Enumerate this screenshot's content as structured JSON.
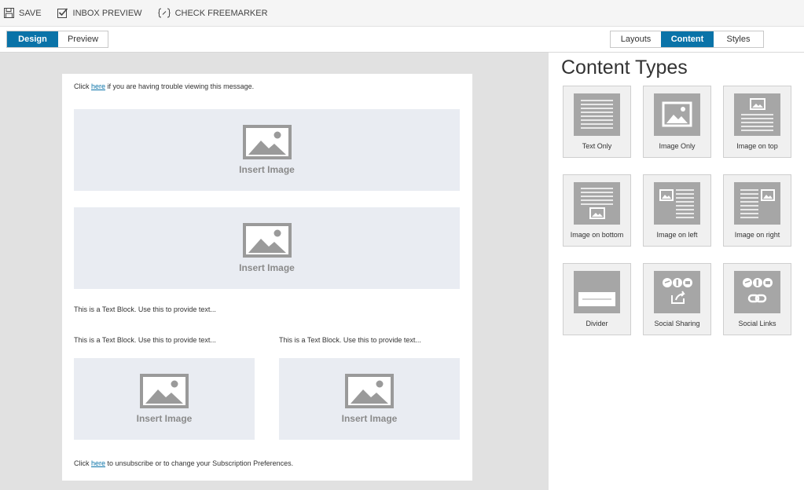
{
  "toolbar": {
    "save": "SAVE",
    "inbox_preview": "INBOX PREVIEW",
    "check_freemarker": "CHECK FREEMARKER"
  },
  "view_tabs": {
    "design": "Design",
    "preview": "Preview",
    "active": "Design"
  },
  "panel_tabs": {
    "layouts": "Layouts",
    "content": "Content",
    "styles": "Styles",
    "active": "Content"
  },
  "email": {
    "header_prefix": "Click ",
    "header_link": "here",
    "header_suffix": " if you are having trouble viewing this message.",
    "insert_image": "Insert Image",
    "text_block": "This is a Text Block. Use this to provide text...",
    "footer_prefix": "Click ",
    "footer_link": "here",
    "footer_suffix": " to unsubscribe or to change your Subscription Preferences."
  },
  "panel": {
    "title": "Content Types",
    "tiles": [
      {
        "label": "Text Only",
        "icon": "text-only-icon"
      },
      {
        "label": "Image Only",
        "icon": "image-only-icon"
      },
      {
        "label": "Image on top",
        "icon": "image-on-top-icon"
      },
      {
        "label": "Image on bottom",
        "icon": "image-on-bottom-icon"
      },
      {
        "label": "Image on left",
        "icon": "image-on-left-icon"
      },
      {
        "label": "Image on right",
        "icon": "image-on-right-icon"
      },
      {
        "label": "Divider",
        "icon": "divider-icon"
      },
      {
        "label": "Social Sharing",
        "icon": "social-sharing-icon"
      },
      {
        "label": "Social Links",
        "icon": "social-links-icon"
      }
    ]
  },
  "colors": {
    "accent": "#0a73a8",
    "canvas_bg": "#e1e1e1",
    "image_placeholder_bg": "#e9ecf2",
    "tile_icon": "#a6a6a6"
  }
}
